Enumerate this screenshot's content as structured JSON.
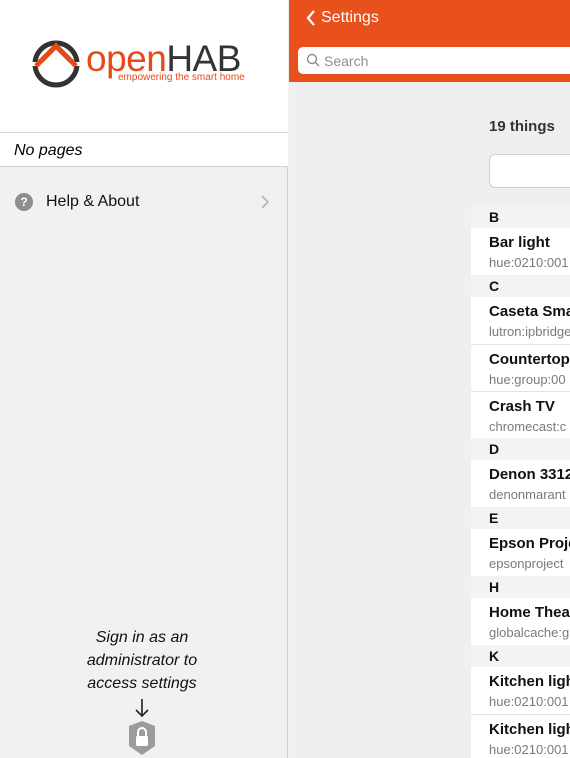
{
  "sidebar": {
    "logo": {
      "open": "open",
      "hab": "HAB",
      "tagline": "empowering the smart home"
    },
    "no_pages": "No pages",
    "help": {
      "label": "Help & About"
    },
    "signin": [
      "Sign in as an",
      "administrator to",
      "access settings"
    ]
  },
  "main": {
    "back_label": "Settings",
    "search": {
      "placeholder": "Search",
      "value": ""
    },
    "count": "19 things",
    "groups": [
      {
        "letter": "B",
        "items": [
          {
            "title": "Bar light",
            "uid": "hue:0210:001"
          }
        ]
      },
      {
        "letter": "C",
        "items": [
          {
            "title": "Caseta Sma",
            "uid": "lutron:ipbridge"
          },
          {
            "title": "Countertops",
            "uid": "hue:group:00"
          },
          {
            "title": "Crash TV",
            "uid": "chromecast:c"
          }
        ]
      },
      {
        "letter": "D",
        "items": [
          {
            "title": "Denon 3312",
            "uid": "denonmarant"
          }
        ]
      },
      {
        "letter": "E",
        "items": [
          {
            "title": "Epson Proje",
            "uid": "epsonproject"
          }
        ]
      },
      {
        "letter": "H",
        "items": [
          {
            "title": "Home Thea",
            "uid": "globalcache:g"
          }
        ]
      },
      {
        "letter": "K",
        "items": [
          {
            "title": "Kitchen ligh",
            "uid": "hue:0210:001"
          },
          {
            "title": "Kitchen ligh",
            "uid": "hue:0210:001"
          }
        ]
      }
    ]
  },
  "colors": {
    "accent": "#e8501c",
    "logo_orange": "#e64a19",
    "logo_dark": "#333333"
  }
}
